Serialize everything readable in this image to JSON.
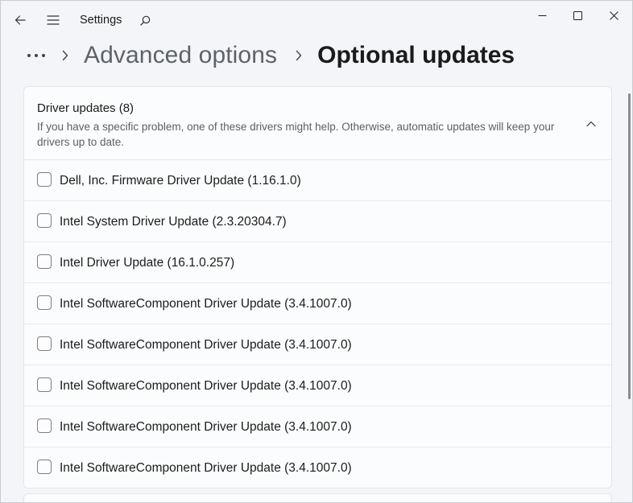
{
  "window": {
    "app_title": "Settings"
  },
  "icons": {
    "back": "back-arrow-icon",
    "menu": "hamburger-menu-icon",
    "search": "search-icon",
    "minimize": "minimize-icon",
    "maximize": "maximize-icon",
    "close": "close-icon",
    "more": "more-ellipsis-icon",
    "breadcrumb_separator": "chevron-right-icon",
    "collapse": "chevron-up-icon"
  },
  "breadcrumb": {
    "parent": "Advanced options",
    "current": "Optional updates"
  },
  "driver_updates": {
    "title": "Driver updates (8)",
    "description": "If you have a specific problem, one of these drivers might help. Otherwise, automatic updates will keep your drivers up to date.",
    "items": [
      {
        "label": "Dell, Inc. Firmware Driver Update (1.16.1.0)",
        "checked": false
      },
      {
        "label": "Intel System Driver Update (2.3.20304.7)",
        "checked": false
      },
      {
        "label": "Intel Driver Update (16.1.0.257)",
        "checked": false
      },
      {
        "label": "Intel SoftwareComponent Driver Update (3.4.1007.0)",
        "checked": false
      },
      {
        "label": "Intel SoftwareComponent Driver Update (3.4.1007.0)",
        "checked": false
      },
      {
        "label": "Intel SoftwareComponent Driver Update (3.4.1007.0)",
        "checked": false
      },
      {
        "label": "Intel SoftwareComponent Driver Update (3.4.1007.0)",
        "checked": false
      },
      {
        "label": "Intel SoftwareComponent Driver Update (3.4.1007.0)",
        "checked": false
      }
    ]
  }
}
